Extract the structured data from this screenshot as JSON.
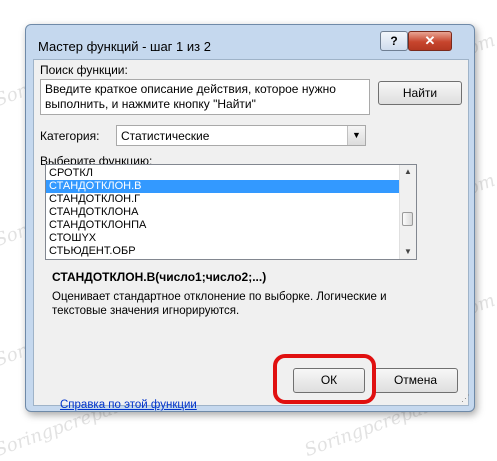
{
  "dialog": {
    "title": "Мастер функций - шаг 1 из 2",
    "help_button": "?",
    "close_button": "✕"
  },
  "search": {
    "label": "Поиск функции:",
    "text": "Введите краткое описание действия, которое нужно выполнить, и нажмите кнопку \"Найти\"",
    "find_button": "Найти"
  },
  "category": {
    "label": "Категория:",
    "selected": "Статистические"
  },
  "functions": {
    "label": "Выберите функцию:",
    "items": [
      "СРОТКЛ",
      "СТАНДОТКЛОН.В",
      "СТАНДОТКЛОН.Г",
      "СТАНДОТКЛОНА",
      "СТАНДОТКЛОНПА",
      "СТОШYX",
      "СТЬЮДЕНТ.ОБР"
    ],
    "selected_index": 1
  },
  "info": {
    "syntax": "СТАНДОТКЛОН.В(число1;число2;...)",
    "description": "Оценивает стандартное отклонение по выборке. Логические и текстовые значения игнорируются."
  },
  "footer": {
    "help_link": "Справка по этой функции",
    "ok_button": "ОК",
    "cancel_button": "Отмена"
  },
  "watermark_text": "Soringpcrepair.com",
  "colors": {
    "selection": "#3399ff",
    "highlight": "#e01010",
    "link": "#0033cc"
  }
}
